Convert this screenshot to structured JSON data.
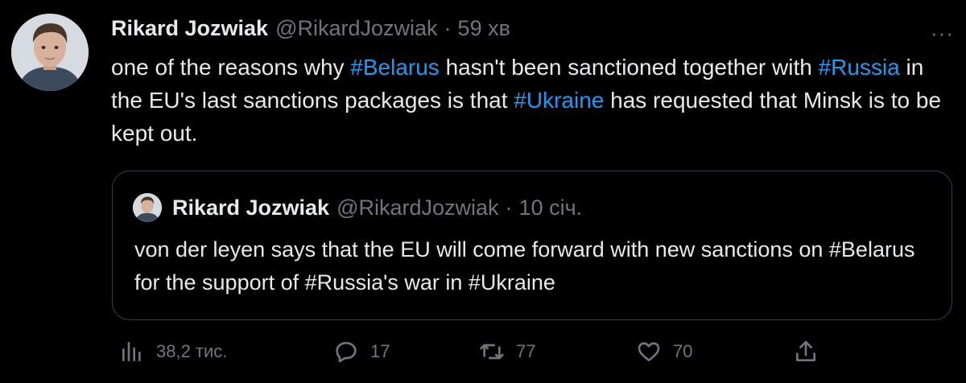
{
  "tweet": {
    "author_name": "Rikard Jozwiak",
    "handle": "@RikardJozwiak",
    "separator": "·",
    "time": "59 хв",
    "more_label": "···",
    "text_parts": [
      {
        "t": "one of the reasons why ",
        "tag": false
      },
      {
        "t": "#Belarus",
        "tag": true
      },
      {
        "t": " hasn't been sanctioned together with ",
        "tag": false
      },
      {
        "t": "#Russia",
        "tag": true
      },
      {
        "t": " in the EU's last sanctions packages is that ",
        "tag": false
      },
      {
        "t": "#Ukraine",
        "tag": true
      },
      {
        "t": " has requested that Minsk is to be kept out.",
        "tag": false
      }
    ]
  },
  "quote": {
    "author_name": "Rikard Jozwiak",
    "handle": "@RikardJozwiak",
    "separator": "·",
    "time": "10 січ.",
    "text": "von der leyen says that the EU will come forward with new sanctions on #Belarus for the support of #Russia's war in #Ukraine"
  },
  "actions": {
    "views": "38,2 тис.",
    "replies": "17",
    "retweets": "77",
    "likes": "70"
  },
  "colors": {
    "background": "#000000",
    "text": "#e7e9ea",
    "muted": "#71767b",
    "hashtag": "#1d9bf0",
    "border": "#3a3f45"
  },
  "icons": [
    "views-icon",
    "reply-icon",
    "retweet-icon",
    "like-icon",
    "share-icon",
    "more-icon"
  ]
}
